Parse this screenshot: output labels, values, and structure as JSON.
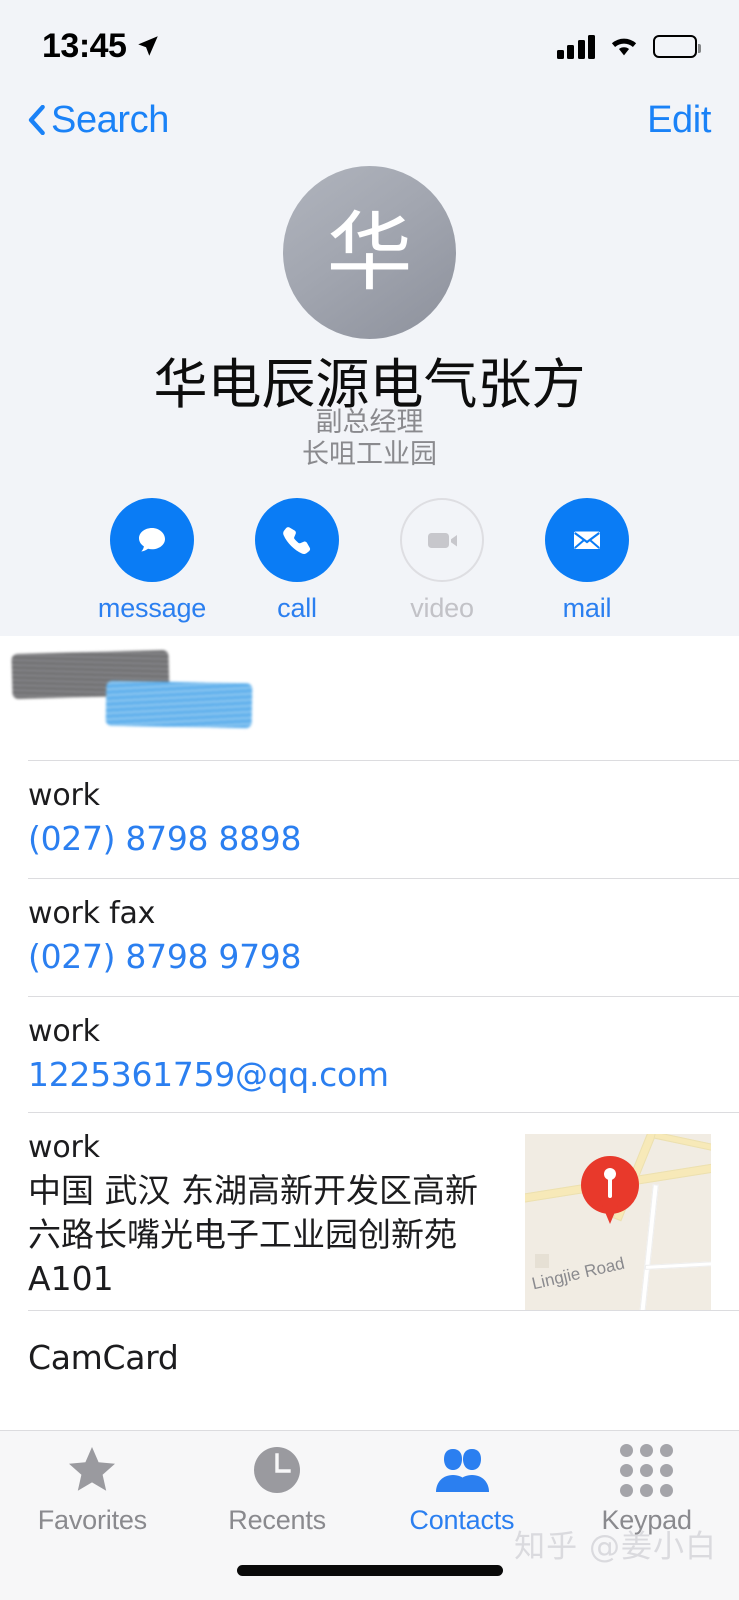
{
  "status_bar": {
    "time": "13:45",
    "location_icon": "location-arrow-icon",
    "signal_icon": "cellular-signal-icon",
    "wifi_icon": "wifi-icon",
    "battery_icon": "battery-icon"
  },
  "nav": {
    "back_label": "Search",
    "back_icon": "chevron-left-icon",
    "edit_label": "Edit"
  },
  "contact": {
    "avatar_initial": "华",
    "name": "华电辰源电气张方",
    "subtitle_1": "副总经理",
    "subtitle_2": "长咀工业园"
  },
  "actions": [
    {
      "label": "message",
      "icon": "message-bubble-icon",
      "enabled": true
    },
    {
      "label": "call",
      "icon": "phone-handset-icon",
      "enabled": true
    },
    {
      "label": "video",
      "icon": "video-camera-icon",
      "enabled": false
    },
    {
      "label": "mail",
      "icon": "envelope-icon",
      "enabled": true
    }
  ],
  "details": [
    {
      "label": "",
      "value": "",
      "type": "redacted"
    },
    {
      "label": "work",
      "value": "(027) 8798 8898",
      "type": "phone"
    },
    {
      "label": "work fax",
      "value": "(027) 8798 9798",
      "type": "phone"
    },
    {
      "label": "work",
      "value": "1225361759@qq.com",
      "type": "email"
    },
    {
      "label": "work",
      "value": "中国 武汉 东湖高新开发区高新六路长嘴光电子工业园创新苑 A101",
      "type": "address"
    },
    {
      "label": "",
      "value": "CamCard",
      "type": "note"
    }
  ],
  "map": {
    "street_label": "Lingjie Road",
    "pin_icon": "map-pin-icon"
  },
  "tabs": [
    {
      "label": "Favorites",
      "icon": "star-icon",
      "active": false
    },
    {
      "label": "Recents",
      "icon": "clock-icon",
      "active": false
    },
    {
      "label": "Contacts",
      "icon": "people-icon",
      "active": true
    },
    {
      "label": "Keypad",
      "icon": "keypad-dots-icon",
      "active": false
    }
  ],
  "watermark": "知乎 @姜小白",
  "colors": {
    "accent_blue": "#0a7cf5",
    "link_blue": "#2b7ff0",
    "header_bg": "#f2f4f8",
    "pin_red": "#e8392b",
    "muted_gray": "#8a8a8e"
  }
}
